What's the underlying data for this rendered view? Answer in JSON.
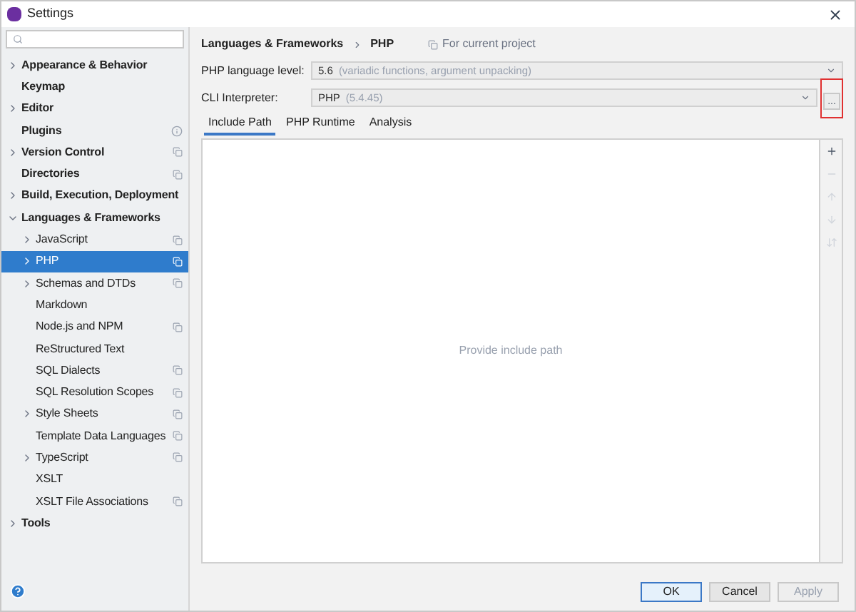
{
  "window": {
    "title": "Settings"
  },
  "sidebar": {
    "items": [
      {
        "label": "Appearance & Behavior",
        "expanded": false,
        "selected": false
      },
      {
        "label": "Keymap",
        "selected": false
      },
      {
        "label": "Editor",
        "expanded": false,
        "selected": false
      },
      {
        "label": "Plugins",
        "selected": false,
        "kind": "info"
      },
      {
        "label": "Version Control",
        "expanded": false,
        "selected": false,
        "kind": "project"
      },
      {
        "label": "Directories",
        "selected": false,
        "kind": "project"
      },
      {
        "label": "Build, Execution, Deployment",
        "expanded": false,
        "selected": false
      },
      {
        "label": "Languages & Frameworks",
        "expanded": true,
        "selected": false,
        "children": [
          {
            "label": "JavaScript",
            "expanded": false,
            "selected": false,
            "kind": "project"
          },
          {
            "label": "PHP",
            "expanded": false,
            "selected": true,
            "kind": "project"
          },
          {
            "label": "Schemas and DTDs",
            "expanded": false,
            "selected": false,
            "kind": "project"
          },
          {
            "label": "Markdown",
            "selected": false
          },
          {
            "label": "Node.js and NPM",
            "selected": false,
            "kind": "project"
          },
          {
            "label": "ReStructured Text",
            "selected": false
          },
          {
            "label": "SQL Dialects",
            "selected": false,
            "kind": "project"
          },
          {
            "label": "SQL Resolution Scopes",
            "selected": false,
            "kind": "project"
          },
          {
            "label": "Style Sheets",
            "expanded": false,
            "selected": false,
            "kind": "project"
          },
          {
            "label": "Template Data Languages",
            "selected": false,
            "kind": "project"
          },
          {
            "label": "TypeScript",
            "expanded": false,
            "selected": false,
            "kind": "project"
          },
          {
            "label": "XSLT",
            "selected": false
          },
          {
            "label": "XSLT File Associations",
            "selected": false,
            "kind": "project"
          }
        ]
      },
      {
        "label": "Tools",
        "expanded": false,
        "selected": false
      }
    ]
  },
  "breadcrumb": [
    "Languages & Frameworks",
    "PHP"
  ],
  "scope_note": "For current project",
  "fields": [
    {
      "label": "PHP language level:",
      "value": "5.6",
      "hint": "(variadic functions, argument unpacking)"
    },
    {
      "label": "CLI Interpreter:",
      "value": "PHP",
      "hint": "(5.4.45)",
      "browse": "...",
      "highlighted": true
    }
  ],
  "tabs": [
    {
      "label": "Include Path",
      "selected": true
    },
    {
      "label": "PHP Runtime",
      "selected": false
    },
    {
      "label": "Analysis",
      "selected": false
    }
  ],
  "empty_text": "Provide include path",
  "toolbar": [
    {
      "kind": "add",
      "disabled": false
    },
    {
      "kind": "remove",
      "disabled": true
    },
    {
      "kind": "up",
      "disabled": true
    },
    {
      "kind": "down",
      "disabled": true
    },
    {
      "kind": "sort",
      "disabled": true
    }
  ],
  "buttons": [
    {
      "label": "OK",
      "default": true,
      "disabled": false
    },
    {
      "label": "Cancel",
      "default": false,
      "disabled": false
    },
    {
      "label": "Apply",
      "default": false,
      "disabled": true
    }
  ]
}
